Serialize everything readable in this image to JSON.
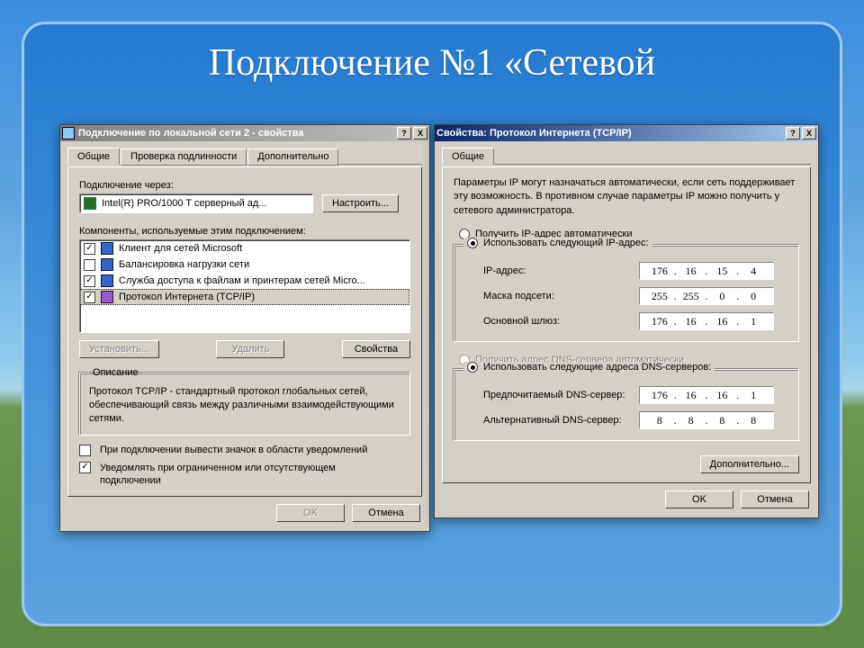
{
  "slide": {
    "title": "Подключение №1 «Сетевой"
  },
  "dlg1": {
    "title": "Подключение по локальной сети 2 - свойства",
    "tabs": {
      "t1": "Общие",
      "t2": "Проверка подлинности",
      "t3": "Дополнительно"
    },
    "connect_via": "Подключение через:",
    "adapter": "Intel(R) PRO/1000 T серверный ад...",
    "configure": "Настроить...",
    "components_label": "Компоненты, используемые этим подключением:",
    "items": {
      "i0": {
        "label": "Клиент для сетей Microsoft",
        "checked": "✓"
      },
      "i1": {
        "label": "Балансировка нагрузки сети",
        "checked": ""
      },
      "i2": {
        "label": "Служба доступа к файлам и принтерам сетей Micro...",
        "checked": "✓"
      },
      "i3": {
        "label": "Протокол Интернета (TCP/IP)",
        "checked": "✓"
      }
    },
    "install": "Установить...",
    "remove": "Удалить",
    "props": "Свойства",
    "desc_title": "Описание",
    "desc": "Протокол TCP/IP - стандартный протокол глобальных сетей, обеспечивающий связь между различными взаимодействующими сетями.",
    "tray": "При подключении вывести значок в области уведомлений",
    "notify": "Уведомлять при ограниченном или отсутствующем подключении",
    "ok": "OK",
    "cancel": "Отмена"
  },
  "dlg2": {
    "title": "Свойства: Протокол Интернета (TCP/IP)",
    "tab": "Общие",
    "helptext": "Параметры IP могут назначаться автоматически, если сеть поддерживает эту возможность. В противном случае параметры IP можно получить у сетевого администратора.",
    "r_auto": "Получить IP-адрес автоматически",
    "r_manual": "Использовать следующий IP-адрес:",
    "ip_l": "IP-адрес:",
    "mask_l": "Маска подсети:",
    "gw_l": "Основной шлюз:",
    "dns_auto": "Получить адрес DNS-сервера автоматически",
    "dns_manual": "Использовать следующие адреса DNS-серверов:",
    "dns1_l": "Предпочитаемый DNS-сервер:",
    "dns2_l": "Альтернативный DNS-сервер:",
    "ip": {
      "a": "176",
      "b": "16",
      "c": "15",
      "d": "4"
    },
    "mask": {
      "a": "255",
      "b": "255",
      "c": "0",
      "d": "0"
    },
    "gw": {
      "a": "176",
      "b": "16",
      "c": "16",
      "d": "1"
    },
    "dns1": {
      "a": "176",
      "b": "16",
      "c": "16",
      "d": "1"
    },
    "dns2": {
      "a": "8",
      "b": "8",
      "c": "8",
      "d": "8"
    },
    "advanced": "Дополнительно...",
    "ok": "OK",
    "cancel": "Отмена"
  }
}
